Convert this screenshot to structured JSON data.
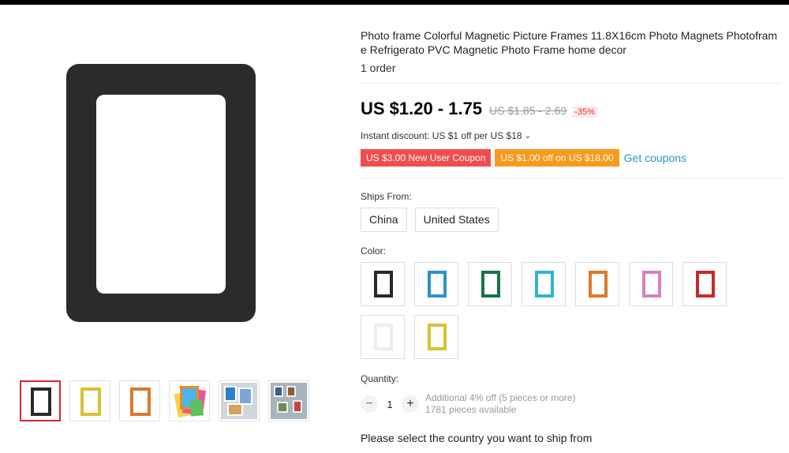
{
  "product": {
    "title": "Photo frame Colorful Magnetic Picture Frames 11.8X16cm Photo Magnets Photoframe Refrigerato PVC Magnetic Photo Frame home decor",
    "orders": "1 order"
  },
  "price": {
    "current": "US $1.20 - 1.75",
    "original": "US $1.85 - 2.69",
    "discount": "-35%"
  },
  "instant_discount": "Instant discount: US $1 off per US $18",
  "coupons": {
    "new_user": "US $3.00 New User Coupon",
    "off": "US $1.00 off on US $18.00",
    "get_coupons": "Get coupons"
  },
  "ships_from": {
    "label": "Ships From:",
    "options": [
      "China",
      "United States"
    ]
  },
  "color": {
    "label": "Color:",
    "swatches": [
      "#2a2a2a",
      "#2f8fd0",
      "#17744a",
      "#2fb6cf",
      "#d97a2c",
      "#d680c2",
      "#c9292b",
      "#ededed",
      "#d7c232"
    ]
  },
  "gallery": {
    "main_color": "#2b2b2b",
    "thumbs": [
      "#2a2a2a",
      "#d7c232",
      "#d97a2c"
    ]
  },
  "quantity": {
    "label": "Quantity:",
    "value": "1",
    "minus": "−",
    "plus": "+",
    "note_line1": "Additional 4% off (5 pieces or more)",
    "note_line2": "1781 pieces available"
  },
  "ship_message": "Please select the country you want to ship from"
}
